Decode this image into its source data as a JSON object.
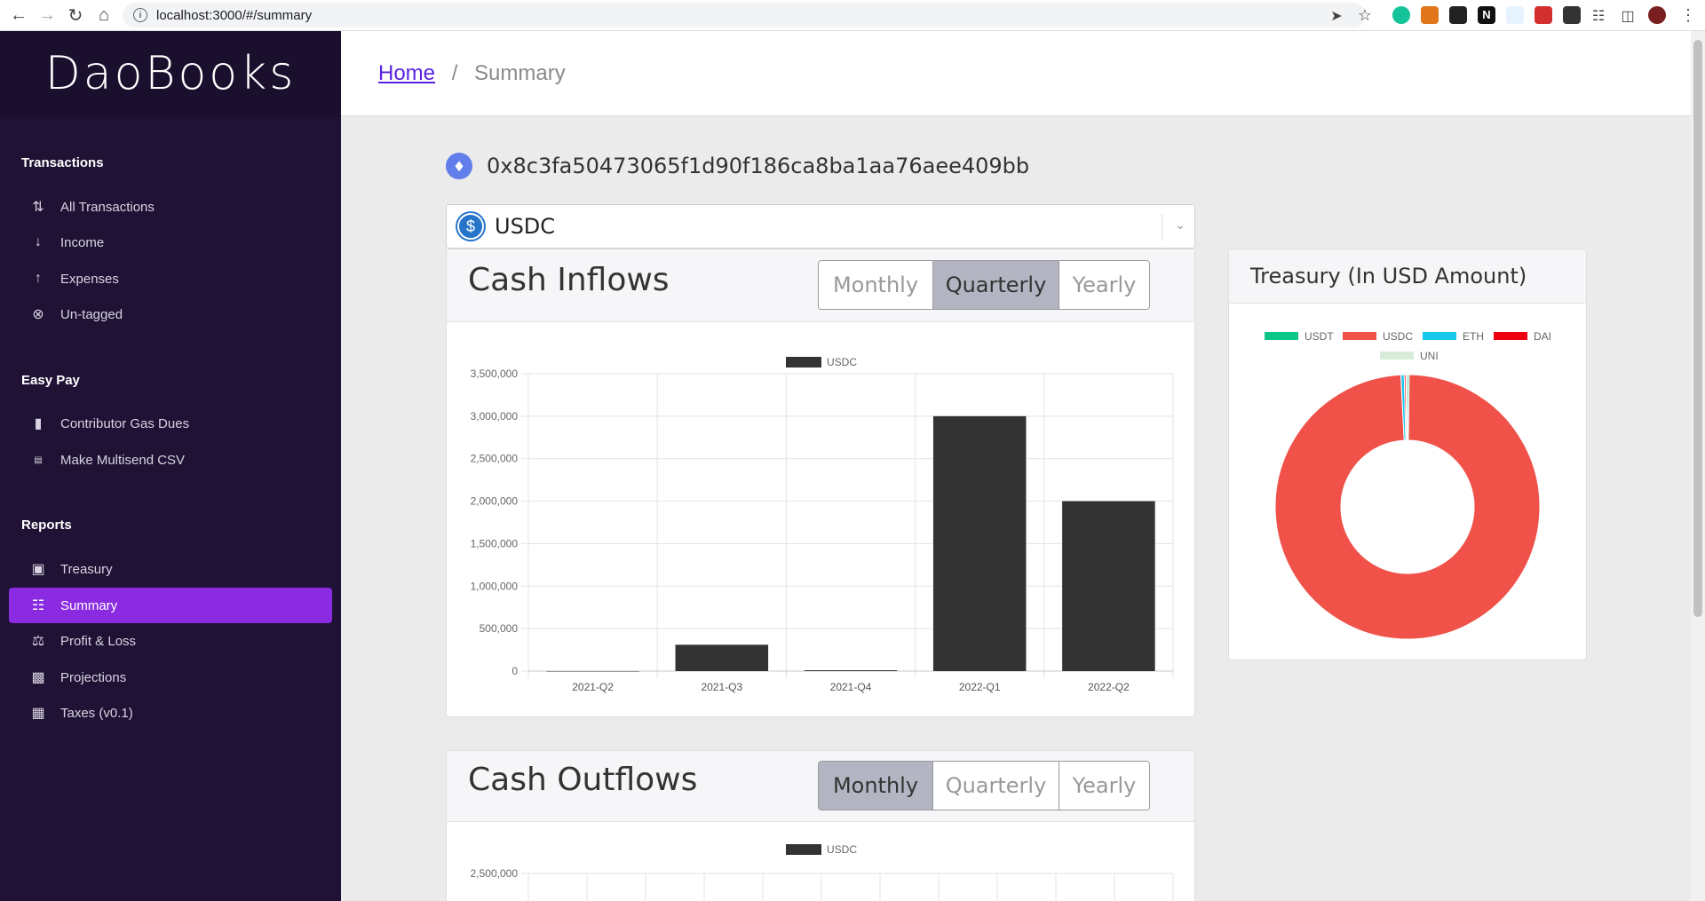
{
  "browser": {
    "url": "localhost:3000/#/summary"
  },
  "sidebar": {
    "brand": "DaoBooks",
    "sections": [
      {
        "title": "Transactions",
        "items": [
          {
            "label": "All Transactions",
            "icon": "arrows-updown-icon"
          },
          {
            "label": "Income",
            "icon": "arrow-down-icon"
          },
          {
            "label": "Expenses",
            "icon": "arrow-up-icon"
          },
          {
            "label": "Un-tagged",
            "icon": "x-circle-icon"
          }
        ]
      },
      {
        "title": "Easy Pay",
        "items": [
          {
            "label": "Contributor Gas Dues",
            "icon": "gas-icon"
          },
          {
            "label": "Make Multisend CSV",
            "icon": "csv-icon"
          }
        ]
      },
      {
        "title": "Reports",
        "items": [
          {
            "label": "Treasury",
            "icon": "safe-icon"
          },
          {
            "label": "Summary",
            "icon": "document-icon"
          },
          {
            "label": "Profit & Loss",
            "icon": "profit-loss-icon"
          },
          {
            "label": "Projections",
            "icon": "bar-chart-icon"
          },
          {
            "label": "Taxes (v0.1)",
            "icon": "tax-icon"
          }
        ]
      }
    ],
    "active": "Summary"
  },
  "header": {
    "home": "Home",
    "separator": "/",
    "current": "Summary"
  },
  "wallet": {
    "address": "0x8c3fa50473065f1d90f186ca8ba1aa76aee409bb"
  },
  "token_select": {
    "value": "USDC"
  },
  "inflows": {
    "title": "Cash Inflows",
    "periods": [
      "Monthly",
      "Quarterly",
      "Yearly"
    ],
    "selected": "Quarterly"
  },
  "outflows": {
    "title": "Cash Outflows",
    "periods": [
      "Monthly",
      "Quarterly",
      "Yearly"
    ],
    "selected": "Monthly"
  },
  "treasury": {
    "title": "Treasury (In USD Amount)"
  },
  "colors": {
    "accent": "#8a2be2",
    "sidebar": "#1f1235",
    "bar": "#333333"
  },
  "chart_data": [
    {
      "type": "bar",
      "categories": [
        "2021-Q2",
        "2021-Q3",
        "2021-Q4",
        "2022-Q1",
        "2022-Q2"
      ],
      "series": [
        {
          "name": "USDC",
          "values": [
            0,
            310000,
            10000,
            3000000,
            2000000
          ]
        }
      ],
      "ylim": [
        0,
        3500000
      ],
      "yticks": [
        "0",
        "500,000",
        "1,000,000",
        "1,500,000",
        "2,000,000",
        "2,500,000",
        "3,000,000",
        "3,500,000"
      ],
      "ytick_values": [
        0,
        500000,
        1000000,
        1500000,
        2000000,
        2500000,
        3000000,
        3500000
      ],
      "grid": true,
      "legend": "top"
    },
    {
      "type": "pie",
      "labels": [
        "USDT",
        "USDC",
        "ETH",
        "DAI",
        "UNI"
      ],
      "colors": [
        "#0fc68a",
        "#f0524a",
        "#18c8ef",
        "#f00010",
        "#d6ecd8"
      ],
      "values": [
        0.2,
        99.0,
        0.4,
        0.2,
        0.2
      ],
      "legend": "top"
    },
    {
      "type": "bar",
      "series": [
        {
          "name": "USDC",
          "values": []
        }
      ],
      "yticks": [
        "2,500,000"
      ],
      "legend": "top"
    }
  ]
}
